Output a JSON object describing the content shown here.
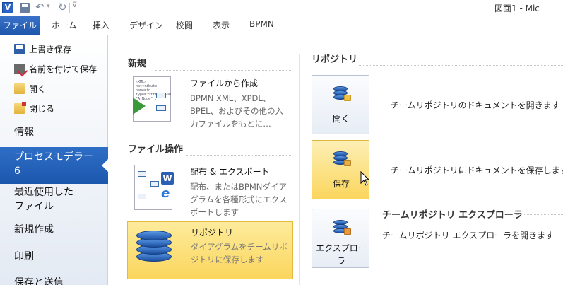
{
  "titlebar": {
    "app_icon_letter": "V",
    "window_title": "図面1 - Mic"
  },
  "ribbon": {
    "file_tab": "ファイル",
    "tabs": [
      "ホーム",
      "挿入",
      "デザイン",
      "校閲",
      "表示",
      "BPMN"
    ]
  },
  "nav": {
    "commands": [
      "上書き保存",
      "名前を付けて保存",
      "開く",
      "閉じる"
    ],
    "info": "情報",
    "active_line1": "プロセスモデラー",
    "active_line2": "6",
    "recent_line1": "最近使用した",
    "recent_line2": "ファイル",
    "new": "新規作成",
    "print": "印刷",
    "save_send": "保存と送信"
  },
  "new_section": {
    "title": "新規",
    "item_title": "ファイルから作成",
    "item_desc": "BPMN XML、XPDL、BPEL、およびその他の入力ファイルをもとに…",
    "thumb_text": "<XML>\n<attribute\nname=id\ntype=\"String\" val\n\"A-Node\" ..."
  },
  "file_ops_section": {
    "title": "ファイル操作",
    "export_title": "配布 & エクスポート",
    "export_desc": "配布、またはBPMNダイアグラムを各種形式にエクスポートします",
    "word_badge": "W",
    "ie_badge": "e",
    "repo_title": "リポジトリ",
    "repo_desc": "ダイアグラムをチームリポジトリに保存します"
  },
  "repo_section": {
    "title": "リポジトリ",
    "open_label": "開く",
    "open_desc": "チームリポジトリのドキュメントを開きます",
    "save_label": "保存",
    "save_desc": "チームリポジトリにドキュメントを保存します",
    "explorer_title": "チームリポジトリ エクスプローラ",
    "explorer_label_line1": "エクスプロー",
    "explorer_label_line2": "ラ",
    "explorer_desc": "チームリポジトリ エクスプローラを開きます"
  }
}
